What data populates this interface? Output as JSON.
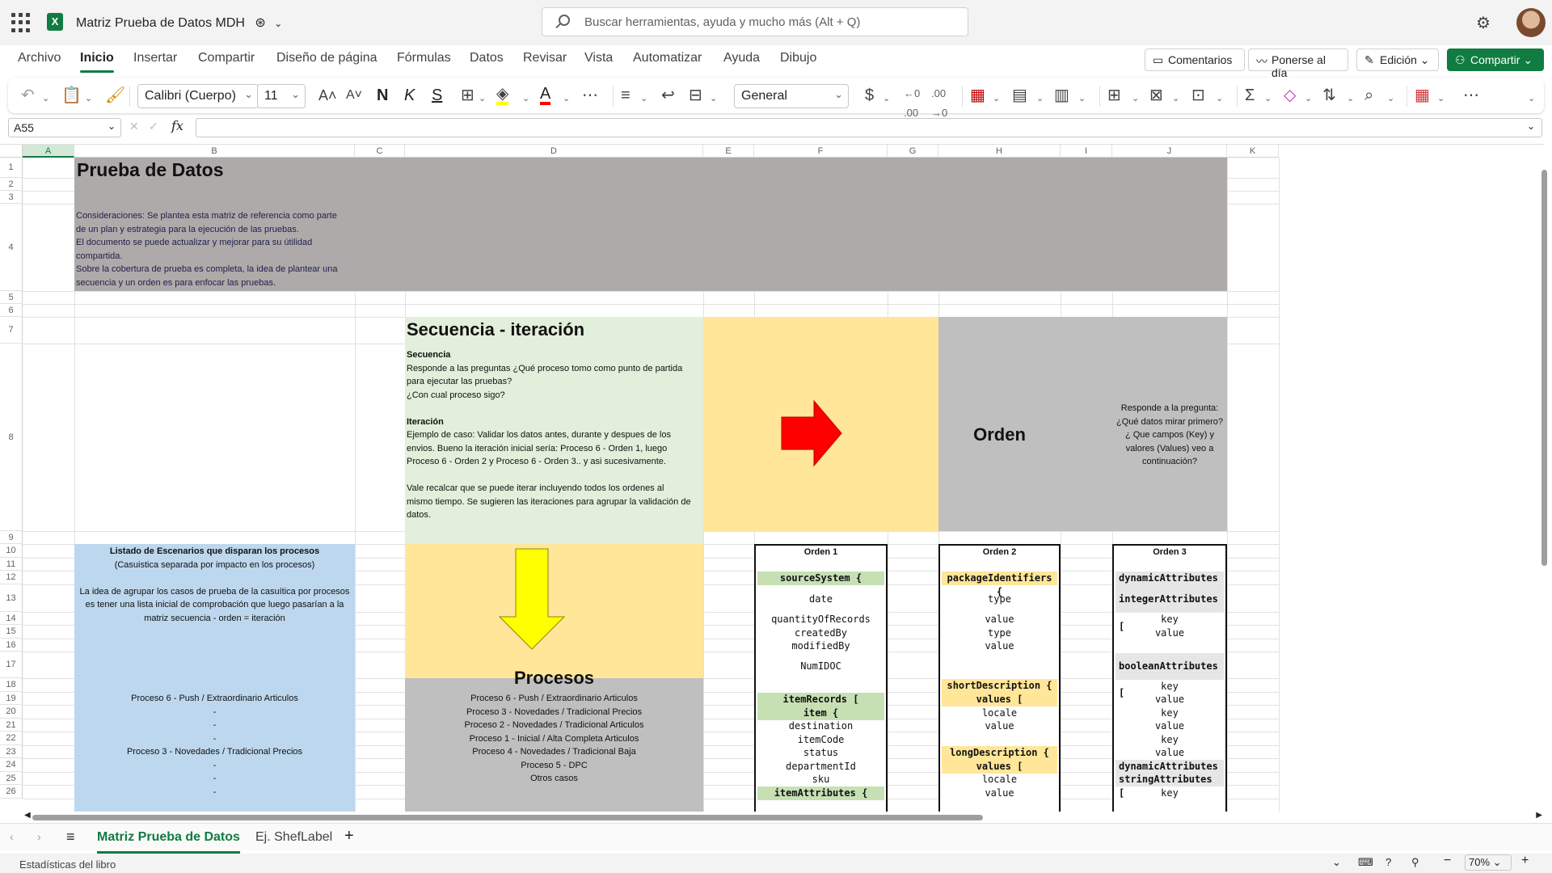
{
  "app": {
    "doc_title": "Matriz Prueba de Datos MDH",
    "search_placeholder": "Buscar herramientas, ayuda y mucho más (Alt + Q)",
    "logo_letter": "X"
  },
  "menu": {
    "tabs": [
      "Archivo",
      "Inicio",
      "Insertar",
      "Compartir",
      "Diseño de página",
      "Fórmulas",
      "Datos",
      "Revisar",
      "Vista",
      "Automatizar",
      "Ayuda",
      "Dibujo"
    ],
    "active": "Inicio",
    "comments_label": "Comentarios",
    "catchup_label": "Ponerse al día",
    "edit_label": "Edición",
    "share_label": "Compartir"
  },
  "ribbon": {
    "font_name": "Calibri (Cuerpo)",
    "font_size": "11",
    "number_format": "General",
    "bold_glyph": "N",
    "italic_glyph": "K",
    "underline_glyph": "S"
  },
  "formula_bar": {
    "cell_ref": "A55",
    "fx": "fx",
    "content": ""
  },
  "grid": {
    "columns": [
      "A",
      "B",
      "C",
      "D",
      "E",
      "F",
      "G",
      "H",
      "I",
      "J",
      "K"
    ],
    "selected_column": "A",
    "rows": [
      "1",
      "2",
      "3",
      "4",
      "5",
      "6",
      "7",
      "8",
      "9",
      "10",
      "11",
      "12",
      "13",
      "14",
      "15",
      "16",
      "17",
      "18",
      "19",
      "20",
      "21",
      "22",
      "23",
      "24",
      "25",
      "26"
    ]
  },
  "content": {
    "title": "Prueba de Datos",
    "considerations_label": "Consideraciones",
    "considerations": [
      "Consideraciones: Se plantea esta matriz de referencia  como parte",
      "de un plan y estrategia para la ejecución de las pruebas.",
      "El documento se puede actualizar  y mejorar para su útilidad",
      "compartida.",
      "Sobre la cobertura de prueba es completa, la idea de plantear una",
      "secuencia y un orden es para enfocar las pruebas."
    ],
    "secuencia_title": "Secuencia - iteración",
    "secuencia_lines": [
      "Secuencia",
      "Responde a las preguntas ¿Qué proceso tomo como punto de partida",
      "para ejecutar las pruebas?",
      "¿Con cual proceso sigo?",
      "",
      "Iteración",
      "Ejemplo de  caso: Validar los datos antes, durante y despues de los",
      "envios. Bueno la iteración inicial sería: Proceso 6 - Orden 1, luego",
      "Proceso 6 - Orden 2  y Proceso 6 - Orden 3.. y asi sucesivamente.",
      "",
      "Vale recalcar que se puede iterar incluyendo todos los ordenes al",
      "mismo tiempo. Se sugieren las iteraciones para agrupar la validación de",
      "datos."
    ],
    "orden_title": "Orden",
    "orden_question": [
      "Responde a la pregunta:",
      "¿Qué datos mirar primero?",
      "¿ Que campos (Key)  y",
      "valores (Values) veo a",
      "continuación?"
    ],
    "escenarios_title": "Listado de Escenarios que disparan los procesos",
    "escenarios_sub": "(Casuistica separada por impacto en los procesos)",
    "escenarios_desc": [
      "La idea de agrupar los casos de prueba de la casuítica por procesos",
      "es tener una lista inicial de comprobación que luego pasarían a la",
      "matriz secuencia - orden = iteración"
    ],
    "escenarios_list": [
      "Proceso 6 - Push / Extraordinario Articulos",
      "-",
      "-",
      "-",
      "Proceso 3 - Novedades / Tradicional Precios",
      "-",
      "-",
      "-"
    ],
    "procesos_title": "Procesos",
    "procesos_list": [
      "Proceso 6 - Push / Extraordinario Articulos",
      "Proceso 3 - Novedades / Tradicional Precios",
      "Proceso 2  - Novedades / Tradicional Articulos",
      "Proceso 1 - Inicial / Alta Completa Articulos",
      "Proceso 4 - Novedades / Tradicional Baja",
      "Proceso 5 - DPC",
      "Otros casos"
    ],
    "orden1_header": "Orden 1",
    "orden2_header": "Orden 2",
    "orden3_header": "Orden 3",
    "orden1_keys": [
      "sourceSystem {",
      "date",
      "quantityOfRecords",
      "createdBy",
      "modifiedBy",
      "NumIDOC",
      "itemRecords [",
      "item {",
      "destination",
      "itemCode",
      "status",
      "departmentId",
      "sku",
      "itemAttributes {"
    ],
    "orden2_keys": [
      "packageIdentifiers {",
      "type",
      "value",
      "type",
      "value",
      "shortDescription {",
      "values [",
      "locale",
      "value",
      "longDescription {",
      "values [",
      "locale",
      "value"
    ],
    "orden3_keys": [
      "dynamicAttributes {",
      "integerAttributes [",
      "key",
      "value",
      "booleanAttributes [",
      "key",
      "value",
      "key",
      "value",
      "key",
      "value",
      "dynamicAttributes {",
      "stringAttributes [",
      "key"
    ]
  },
  "sheets": {
    "tabs": [
      "Matriz Prueba de Datos",
      "Ej. ShefLabel"
    ],
    "active": "Matriz Prueba de Datos"
  },
  "status": {
    "left_text": "Estadísticas del libro",
    "zoom": "70%"
  },
  "colors": {
    "excel_green": "#107c41",
    "gray_header": "#aeaaaa",
    "light_green": "#e2efda",
    "yellow": "#ffe699",
    "light_blue": "#bdd7ee",
    "arrow_red": "#ff0000",
    "arrow_yellow": "#ffff00"
  }
}
